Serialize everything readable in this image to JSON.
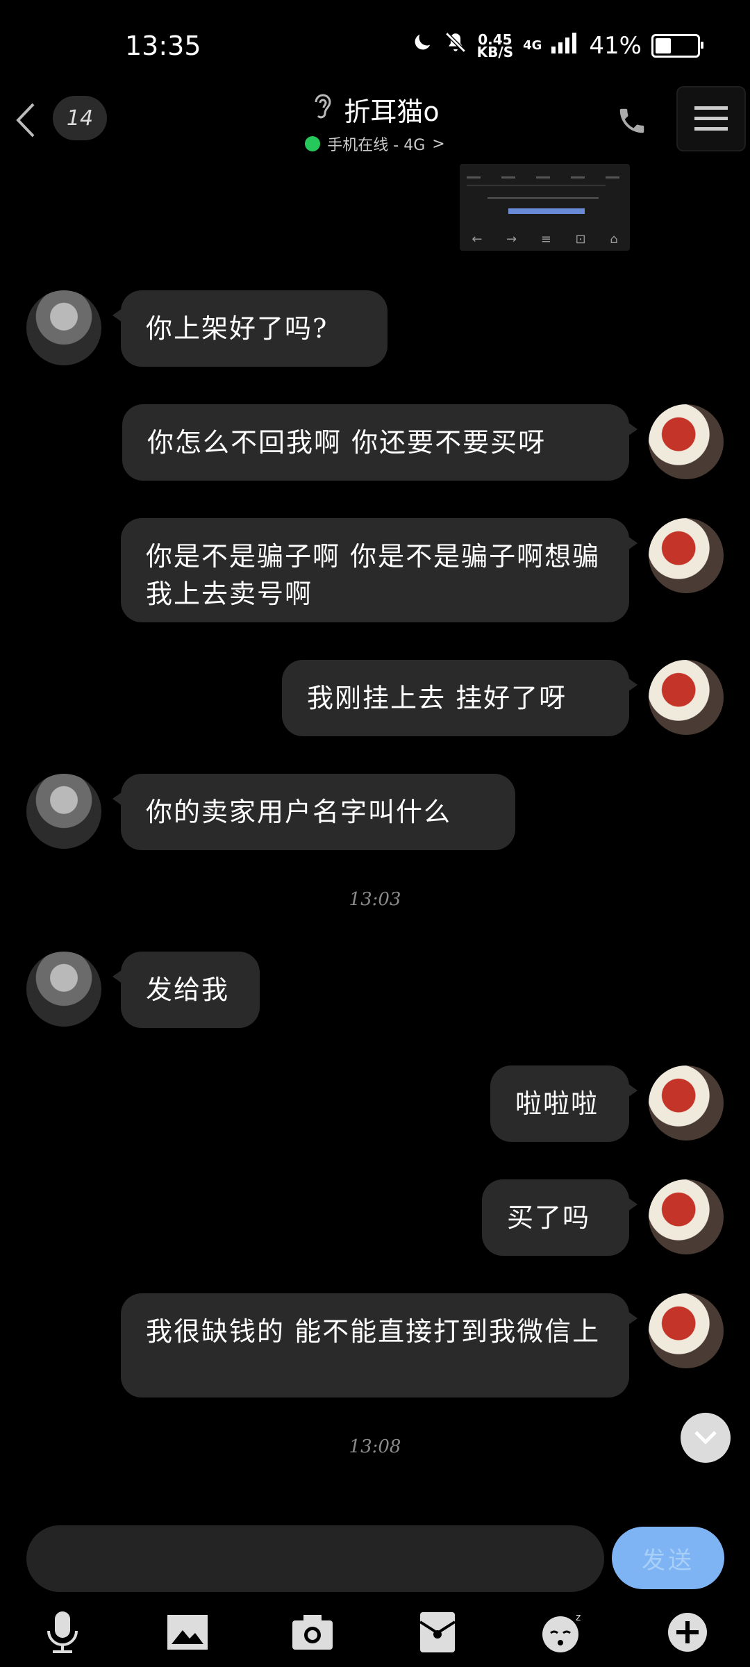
{
  "status_bar": {
    "time": "13:35",
    "net_speed_value": "0.45",
    "net_speed_unit": "KB/S",
    "network_type": "4G",
    "battery_percent": "41%",
    "battery_level": 0.41
  },
  "header": {
    "unread_count": "14",
    "contact_name": "折耳猫o",
    "presence_text": "手机在线 - 4G",
    "presence_chevron": ">",
    "presence_color": "#27c85b"
  },
  "messages": [
    {
      "side": "left",
      "text": "你上架好了吗?"
    },
    {
      "side": "right",
      "text": "你怎么不回我啊 你还要不要买呀"
    },
    {
      "side": "right",
      "text": "你是不是骗子啊 你是不是骗子啊想骗我上去卖号啊"
    },
    {
      "side": "right",
      "text": "我刚挂上去 挂好了呀"
    },
    {
      "side": "left",
      "text": "你的卖家用户名字叫什么"
    },
    {
      "side": "left",
      "text": "发给我"
    },
    {
      "side": "right",
      "text": "啦啦啦"
    },
    {
      "side": "right",
      "text": "买了吗"
    },
    {
      "side": "right",
      "text": "我很缺钱的 能不能直接打到我微信上"
    }
  ],
  "timestamps": [
    "13:03",
    "13:08"
  ],
  "input": {
    "send_label": "发送",
    "send_color": "#7fb4f4"
  },
  "toolbar": {
    "icons": [
      "microphone-icon",
      "image-icon",
      "camera-icon",
      "red-packet-icon",
      "emoji-icon",
      "plus-icon"
    ]
  }
}
